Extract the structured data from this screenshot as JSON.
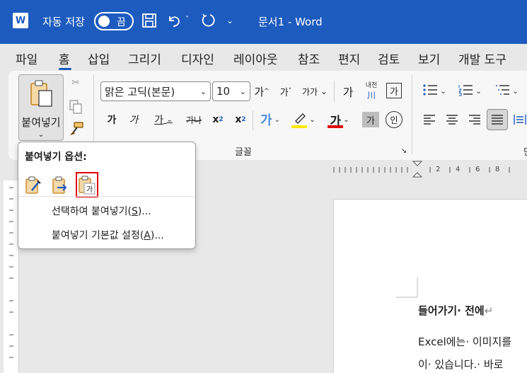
{
  "titlebar": {
    "logo_letter": "W",
    "autosave_label": "자동 저장",
    "autosave_state": "끔",
    "document_title": "문서1  -  Word"
  },
  "tabs": [
    "파일",
    "홈",
    "삽입",
    "그리기",
    "디자인",
    "레이아웃",
    "참조",
    "편지",
    "검토",
    "보기",
    "개발 도구"
  ],
  "ribbon": {
    "paste_label": "붙여넣기",
    "font_name": "맑은 고딕(본문)",
    "font_size": "10",
    "grow_font": "가",
    "shrink_font": "가",
    "change_case": "가가",
    "clear_format": "가",
    "phonetic_top": "내천",
    "phonetic_bottom": "川",
    "char_border": "가",
    "bold": "가",
    "italic": "가",
    "underline": "가",
    "strikethrough": "가나",
    "subscript": "x",
    "superscript": "x",
    "text_effect": "가",
    "font_color": "가",
    "char_shading": "가",
    "enclosed_char": "인",
    "font_group_label": "글꼴",
    "next_group_label": "단"
  },
  "ruler": {
    "marks": [
      "2",
      "4",
      "6",
      "8"
    ]
  },
  "document": {
    "line1": "들어가기· 전에",
    "line2": "Excel에는· 이미지를",
    "line3": "이· 있습니다.· 바로"
  },
  "paste_popup": {
    "title": "붙여넣기 옵션:",
    "item1_text": "선택하여 붙여넣기(",
    "item1_key": "S",
    "item1_tail": ")...",
    "item2_text": "붙여넣기 기본값 설정(",
    "item2_key": "A",
    "item2_tail": ")..."
  },
  "colors": {
    "title_blue": "#1d5bbf",
    "font_color_red": "#e00000",
    "highlight_yellow": "#ffe800"
  }
}
